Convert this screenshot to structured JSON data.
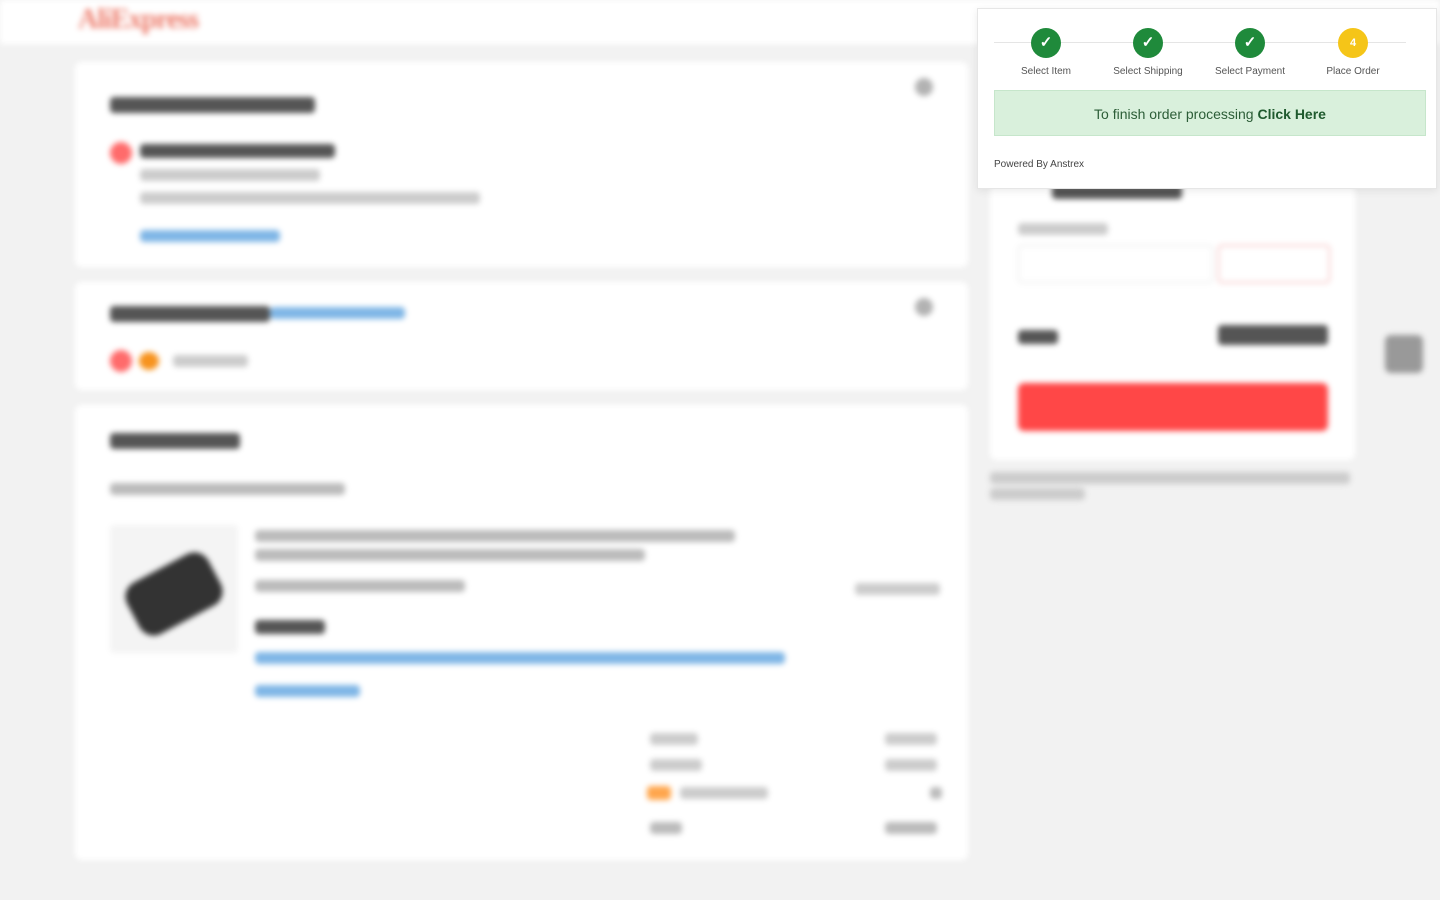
{
  "wizard": {
    "steps": [
      {
        "label": "Select Item",
        "symbol": "✓",
        "status": "done"
      },
      {
        "label": "Select Shipping",
        "symbol": "✓",
        "status": "done"
      },
      {
        "label": "Select Payment",
        "symbol": "✓",
        "status": "done"
      },
      {
        "label": "Place Order",
        "symbol": "4",
        "status": "current"
      }
    ],
    "banner_text": "To finish order processing",
    "banner_link": "Click Here",
    "powered_by": "Powered By Anstrex"
  },
  "colors": {
    "step_done": "#1f8a3b",
    "step_current": "#f5c518",
    "banner_bg": "#d9f0dc",
    "place_order_button": "#ff4747"
  }
}
